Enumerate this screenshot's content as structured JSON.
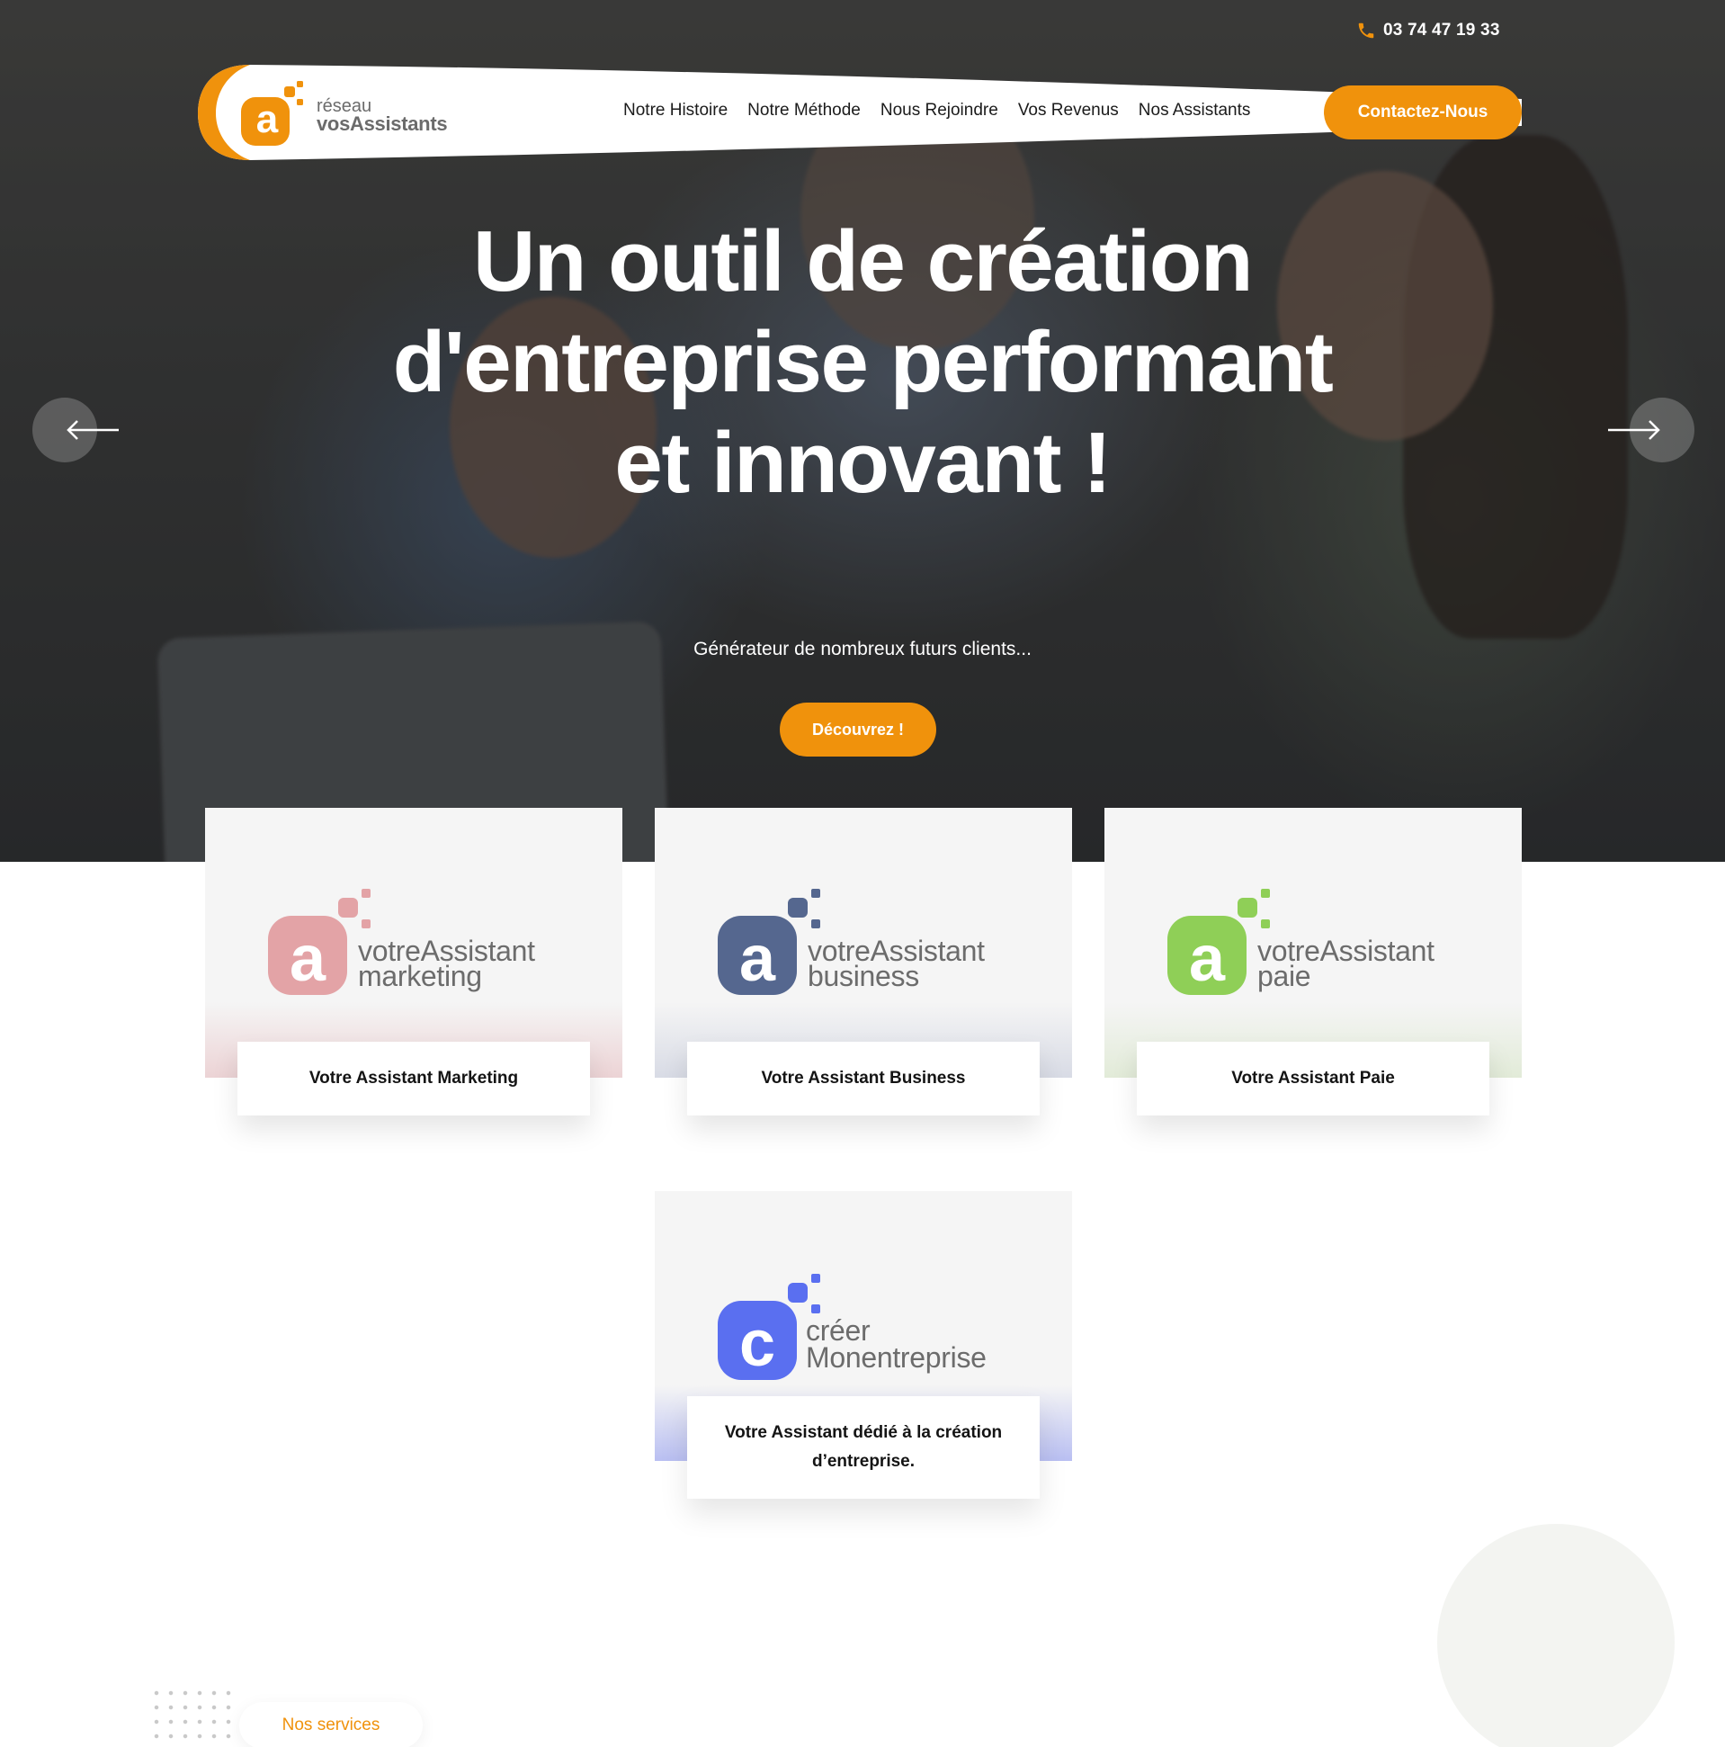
{
  "topbar": {
    "phone": "03 74 47 19 33",
    "phone_icon": "phone-icon"
  },
  "logo": {
    "line1": "réseau",
    "line2": "vosAssistants",
    "mark_letter": "a"
  },
  "nav": {
    "links": [
      "Notre Histoire",
      "Notre Méthode",
      "Nous Rejoindre",
      "Vos Revenus",
      "Nos Assistants"
    ],
    "cta": "Contactez-Nous"
  },
  "hero": {
    "title": "Un outil de création d'entreprise performant et innovant !",
    "subtitle": "Générateur de nombreux futurs clients...",
    "button": "Découvrez !",
    "prev_icon": "arrow-left-icon",
    "next_icon": "arrow-right-icon"
  },
  "cards": [
    {
      "logo_line1": "votreAssistant",
      "logo_line2": "marketing",
      "mark_letter": "a",
      "label": "Votre Assistant Marketing",
      "color": "#e3a3a6"
    },
    {
      "logo_line1": "votreAssistant",
      "logo_line2": "business",
      "mark_letter": "a",
      "label": "Votre Assistant Business",
      "color": "#55678f"
    },
    {
      "logo_line1": "votreAssistant",
      "logo_line2": "paie",
      "mark_letter": "a",
      "label": "Votre Assistant Paie",
      "color": "#8fcf57"
    },
    {
      "logo_line1": "créer",
      "logo_line2": "Monentreprise",
      "mark_letter": "c",
      "label": "Votre Assistant dédié à la création d’entreprise.",
      "color": "#5a6ff0"
    }
  ],
  "sections": {
    "services_pill": "Nos services"
  },
  "colors": {
    "accent": "#f0920c",
    "text_dark": "#141414",
    "card_bg": "#f5f5f5"
  }
}
